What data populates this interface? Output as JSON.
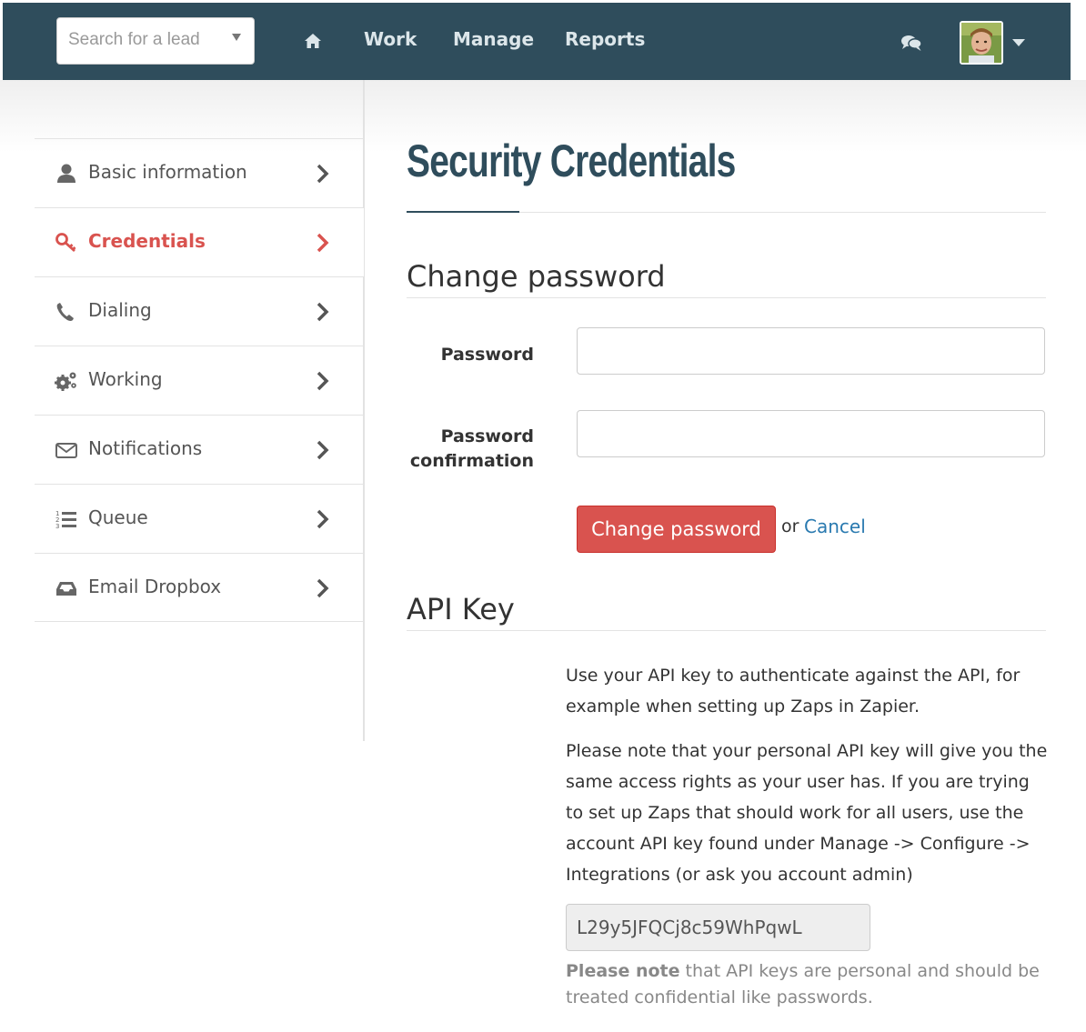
{
  "topbar": {
    "search_placeholder": "Search for a lead",
    "nav": {
      "work": "Work",
      "manage": "Manage",
      "reports": "Reports"
    },
    "home_icon": "home-icon",
    "chat_icon": "chat-icon",
    "colors": {
      "background": "#2f4d5c",
      "link": "#dce6ea"
    }
  },
  "sidebar": {
    "items": [
      {
        "label": "Basic information",
        "icon": "user-icon"
      },
      {
        "label": "Credentials",
        "icon": "key-icon",
        "active": true
      },
      {
        "label": "Dialing",
        "icon": "phone-icon"
      },
      {
        "label": "Working",
        "icon": "gears-icon"
      },
      {
        "label": "Notifications",
        "icon": "envelope-icon"
      },
      {
        "label": "Queue",
        "icon": "ordered-list-icon"
      },
      {
        "label": "Email Dropbox",
        "icon": "inbox-icon"
      }
    ],
    "active_color": "#d9534f"
  },
  "main": {
    "title": "Security Credentials",
    "change_password": {
      "heading": "Change password",
      "password_label": "Password",
      "confirmation_label_line1": "Password",
      "confirmation_label_line2": "confirmation",
      "password_value": "",
      "confirmation_value": "",
      "submit_label": "Change password",
      "or_text": "or",
      "cancel_label": "Cancel"
    },
    "api_key": {
      "heading": "API Key",
      "para1": "Use your API key to authenticate against the API, for example when setting up Zaps in Zapier.",
      "para2": "Please note that your personal API key will give you the same access rights as your user has. If you are trying to set up Zaps that should work for all users, use the account API key found under Manage -> Configure -> Integrations (or ask you account admin)",
      "key_value": "L29y5JFQCj8c59WhPqwL",
      "note_bold": "Please note",
      "note_rest": " that API keys are personal and should be treated confidential like passwords."
    }
  }
}
